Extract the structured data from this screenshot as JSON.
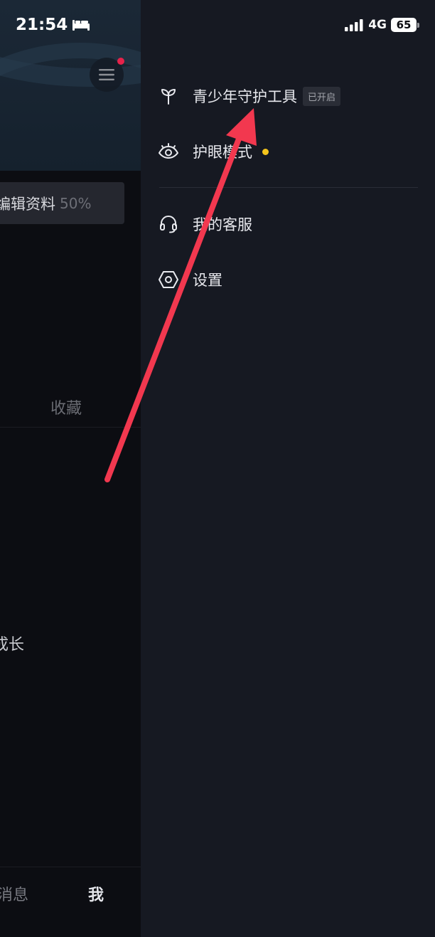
{
  "status_bar": {
    "time": "21:54",
    "network": "4G",
    "battery": "65"
  },
  "profile_background": {
    "edit_profile_label": "编辑资料",
    "edit_profile_percent": "50%",
    "favorites_tab": "收藏",
    "growth_label": "成长",
    "nav_messages": "消息",
    "nav_me": "我"
  },
  "drawer": {
    "items": [
      {
        "label": "青少年守护工具",
        "badge": "已开启",
        "icon": "sprout-icon"
      },
      {
        "label": "护眼模式",
        "icon": "eye-icon"
      },
      {
        "label": "我的客服",
        "icon": "headset-icon"
      },
      {
        "label": "设置",
        "icon": "hexagon-settings-icon"
      }
    ]
  },
  "colors": {
    "drawer_bg": "#161922",
    "page_bg": "#0c0d12",
    "annotation_arrow": "#f2384f",
    "notice_dot": "#f5c51c",
    "menu_badge_dot": "#e6224a"
  }
}
